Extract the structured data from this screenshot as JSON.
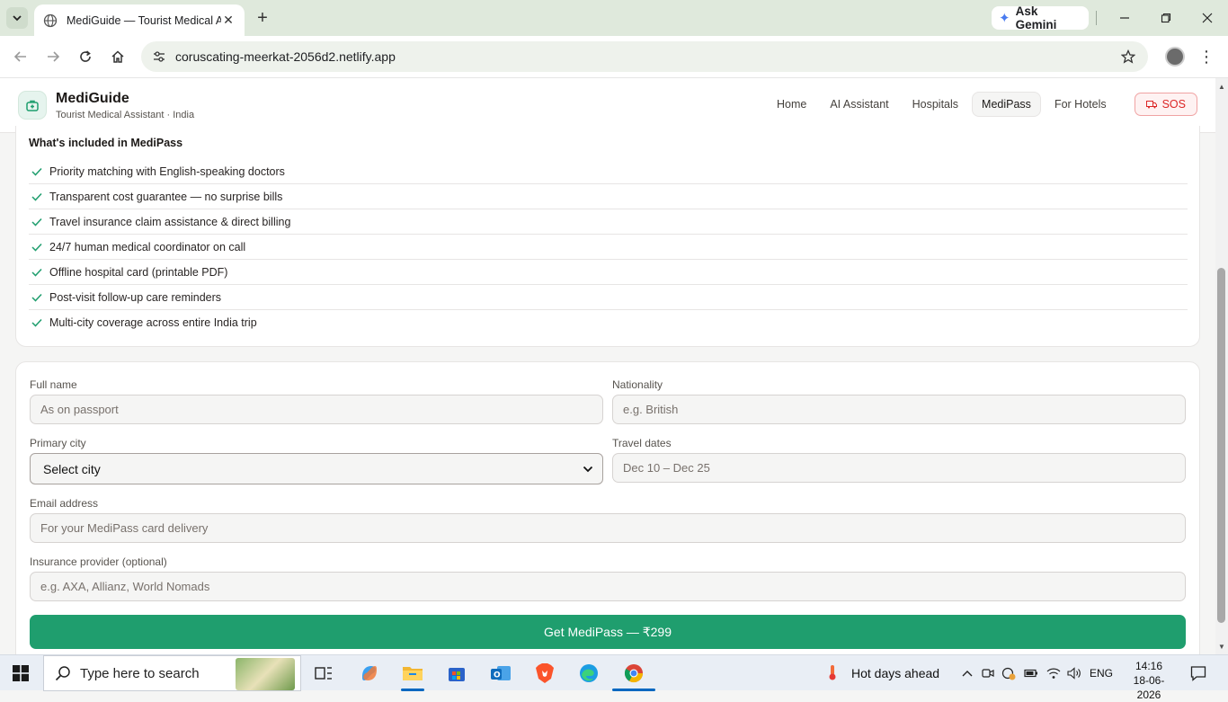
{
  "browser": {
    "tab_title": "MediGuide — Tourist Medical Assistant",
    "url": "coruscating-meerkat-2056d2.netlify.app",
    "gemini_label": "Ask Gemini"
  },
  "header": {
    "brand_name": "MediGuide",
    "brand_sub": "Tourist Medical Assistant · India",
    "nav": {
      "home": "Home",
      "ai": "AI Assistant",
      "hospitals": "Hospitals",
      "medipass": "MediPass",
      "hotels": "For Hotels",
      "sos": "SOS"
    }
  },
  "features": {
    "title": "What's included in MediPass",
    "items": [
      "Priority matching with English-speaking doctors",
      "Transparent cost guarantee — no surprise bills",
      "Travel insurance claim assistance & direct billing",
      "24/7 human medical coordinator on call",
      "Offline hospital card (printable PDF)",
      "Post-visit follow-up care reminders",
      "Multi-city coverage across entire India trip"
    ]
  },
  "form": {
    "full_name_label": "Full name",
    "full_name_placeholder": "As on passport",
    "nationality_label": "Nationality",
    "nationality_placeholder": "e.g. British",
    "city_label": "Primary city",
    "city_value": "Select city",
    "dates_label": "Travel dates",
    "dates_placeholder": "Dec 10 – Dec 25",
    "email_label": "Email address",
    "email_placeholder": "For your MediPass card delivery",
    "insurance_label": "Insurance provider (optional)",
    "insurance_placeholder": "e.g. AXA, Allianz, World Nomads",
    "submit_label": "Get MediPass — ₹299"
  },
  "taskbar": {
    "search_placeholder": "Type here to search",
    "weather": "Hot days ahead",
    "lang": "ENG",
    "time": "14:16",
    "date": "18-06-2026"
  },
  "colors": {
    "accent": "#1f9e6e",
    "sos": "#dc2626"
  }
}
